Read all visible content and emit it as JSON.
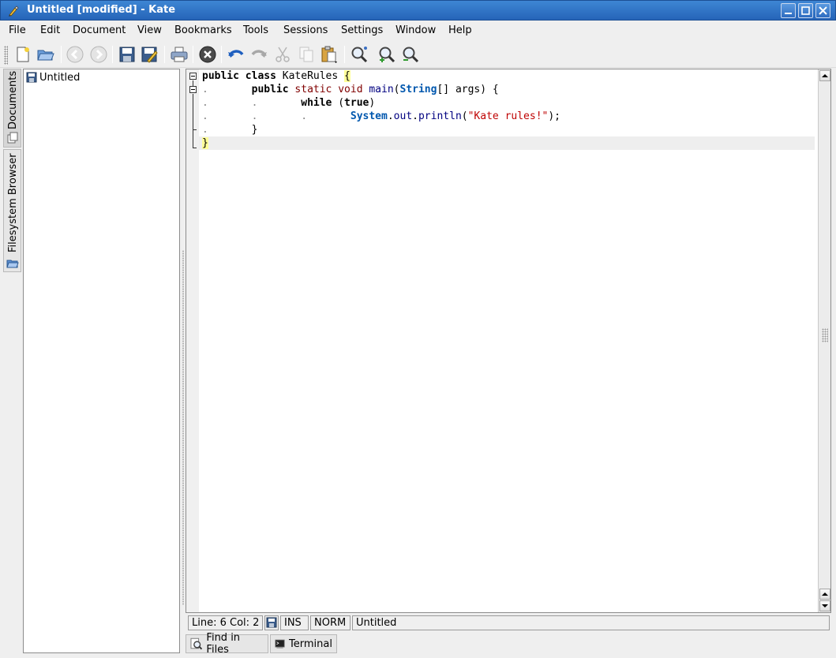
{
  "window": {
    "title": "Untitled [modified] - Kate"
  },
  "menu": [
    "File",
    "Edit",
    "Document",
    "View",
    "Bookmarks",
    "Tools",
    "Sessions",
    "Settings",
    "Window",
    "Help"
  ],
  "toolbar": {
    "icons": [
      "new-file-icon",
      "open-file-icon",
      "back-icon",
      "forward-icon",
      "save-icon",
      "save-as-icon",
      "print-icon",
      "close-document-icon",
      "undo-icon",
      "redo-icon",
      "cut-icon",
      "copy-icon",
      "paste-icon",
      "find-icon",
      "zoom-in-icon",
      "zoom-out-icon"
    ]
  },
  "side_tabs": {
    "documents": "Documents",
    "filesystem": "Filesystem Browser"
  },
  "document_list": {
    "items": [
      "Untitled"
    ]
  },
  "code": {
    "lines": [
      "public class KateRules {",
      "public static void main(String[] args) {",
      "while (true)",
      "System.out.println(\"Kate rules!\");",
      "}",
      "}"
    ],
    "string_literal": "\"Kate rules!\""
  },
  "status": {
    "position": "Line: 6 Col: 2",
    "insert_mode": "INS",
    "edit_mode": "NORM",
    "document": "Untitled"
  },
  "bottom_tabs": [
    "Find in Files",
    "Terminal"
  ],
  "colors": {
    "titlebar": "#2e6cc0",
    "keyword_type": "#800000",
    "data_type": "#0057ae",
    "string": "#bf0303",
    "bracket_highlight": "#ffff99"
  }
}
